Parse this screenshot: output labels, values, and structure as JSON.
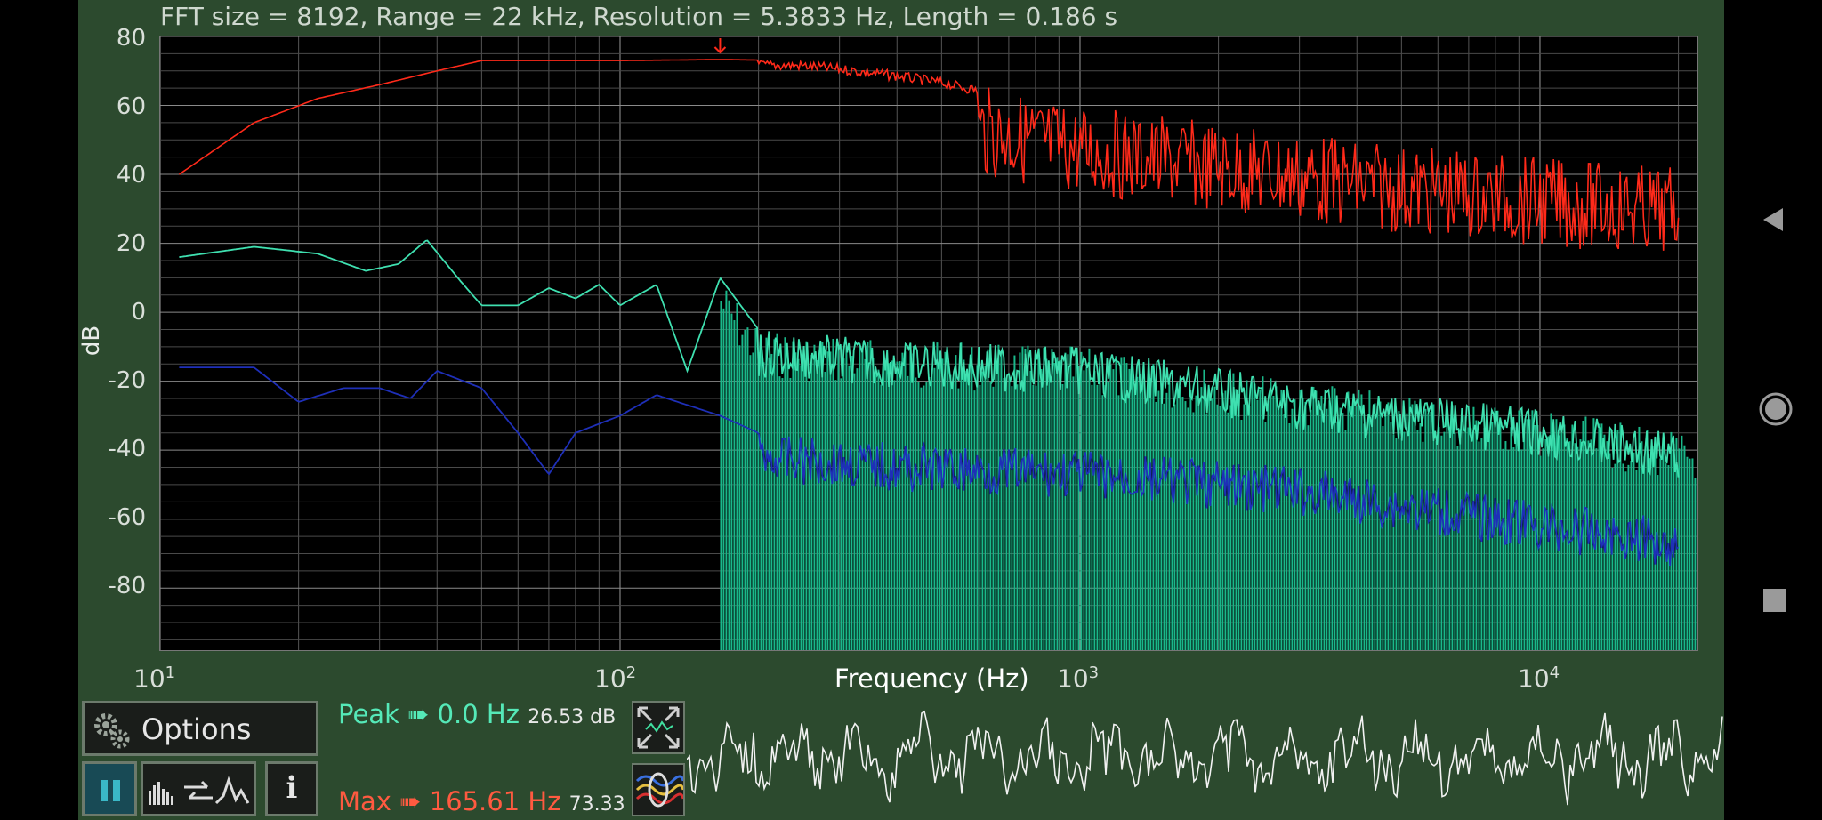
{
  "header": {
    "info": "FFT size = 8192, Range = 22 kHz, Resolution = 5.3833 Hz, Length = 0.186 s"
  },
  "chart_data": {
    "type": "line",
    "title": "",
    "xlabel": "Frequency (Hz)",
    "ylabel": "dB",
    "xscale": "log",
    "xlim": [
      10,
      22000
    ],
    "ylim": [
      -98,
      80
    ],
    "grid": true,
    "yticks": [
      "80",
      "60",
      "40",
      "20",
      "0",
      "-20",
      "-40",
      "-60",
      "-80"
    ],
    "xticks": [
      {
        "base": "10",
        "exp": "1"
      },
      {
        "base": "10",
        "exp": "2"
      },
      {
        "base": "10",
        "exp": "3"
      },
      {
        "base": "10",
        "exp": "4"
      }
    ],
    "series": [
      {
        "color": "#ff2a1a",
        "x": [
          11,
          16,
          22,
          30,
          40,
          50,
          70,
          100,
          165,
          250,
          300,
          400,
          500,
          700,
          1000,
          2000,
          4000,
          10000,
          20000
        ],
        "y": [
          40,
          55,
          62,
          66,
          70,
          73,
          73,
          73,
          73.3,
          73,
          72,
          70,
          68,
          64,
          60,
          55,
          50,
          45,
          42
        ]
      },
      {
        "color": "#3fe0b0",
        "x": [
          11,
          16,
          22,
          28,
          33,
          38,
          45,
          50,
          60,
          70,
          80,
          90,
          100,
          120,
          140,
          165,
          200,
          400,
          1000,
          3000,
          10000,
          20000
        ],
        "y": [
          16,
          19,
          17,
          12,
          14,
          21,
          9,
          2,
          2,
          7,
          4,
          8,
          2,
          8,
          -17,
          10,
          -5,
          -8,
          -10,
          -20,
          -28,
          -35
        ]
      },
      {
        "color": "#1e2fb8",
        "x": [
          11,
          16,
          20,
          25,
          30,
          35,
          40,
          50,
          60,
          70,
          80,
          100,
          120,
          165,
          200,
          400,
          1000,
          3000,
          10000,
          20000
        ],
        "y": [
          -16,
          -16,
          -26,
          -22,
          -22,
          -25,
          -17,
          -22,
          -35,
          -47,
          -35,
          -30,
          -24,
          -30,
          -35,
          -38,
          -40,
          -45,
          -55,
          -60
        ]
      }
    ],
    "spectrum_fill": {
      "color": "#1ab88a",
      "start_hz": 165
    }
  },
  "status": {
    "peak_prefix": "Peak ➠ 0.0 Hz",
    "peak_db": "26.53 dB",
    "max_prefix": "Max ➠ 165.61 Hz",
    "max_db": "73.33 dB"
  },
  "controls": {
    "options_label": "Options",
    "info_label": "i"
  },
  "colors": {
    "background": "#2c4a2e",
    "plot": "#000000",
    "peak": "#55e9b8",
    "max": "#ff5a40"
  },
  "icons": [
    "gear-icon",
    "pause-icon",
    "spectrum-mode-icon",
    "info-icon",
    "fit-zoom-icon",
    "waveform-icon",
    "back-icon",
    "home-icon",
    "recents-icon"
  ]
}
